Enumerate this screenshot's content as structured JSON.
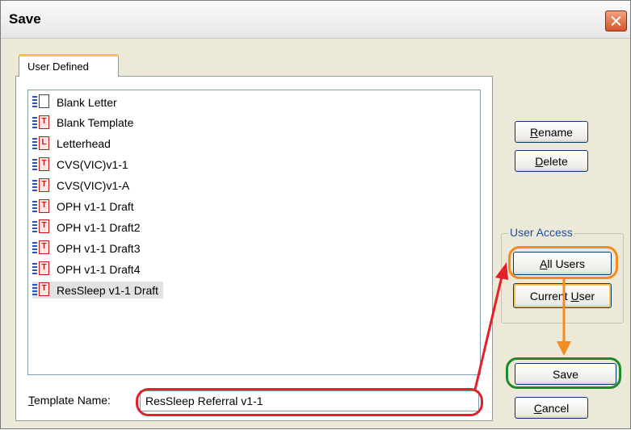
{
  "dialog": {
    "title": "Save"
  },
  "tabs": [
    {
      "label": "User Defined",
      "selected": true
    }
  ],
  "templates": [
    {
      "label": "Blank Letter",
      "icon": "blank-letter-icon",
      "glyph": "",
      "selected": false
    },
    {
      "label": "Blank Template",
      "icon": "template-icon",
      "glyph": "T",
      "selected": false
    },
    {
      "label": "Letterhead",
      "icon": "letterhead-icon",
      "glyph": "L",
      "selected": false
    },
    {
      "label": "CVS(VIC)v1-1",
      "icon": "template-icon",
      "glyph": "T",
      "selected": false
    },
    {
      "label": "CVS(VIC)v1-A",
      "icon": "template-icon",
      "glyph": "T",
      "selected": false
    },
    {
      "label": "OPH v1-1 Draft",
      "icon": "template-icon",
      "glyph": "T",
      "selected": false
    },
    {
      "label": "OPH v1-1 Draft2",
      "icon": "template-icon",
      "glyph": "T",
      "selected": false
    },
    {
      "label": "OPH v1-1 Draft3",
      "icon": "template-icon",
      "glyph": "T",
      "selected": false
    },
    {
      "label": "OPH v1-1 Draft4",
      "icon": "template-icon",
      "glyph": "T",
      "selected": false
    },
    {
      "label": "ResSleep v1-1 Draft",
      "icon": "template-icon",
      "glyph": "T",
      "selected": true
    }
  ],
  "buttons": {
    "rename": {
      "label": "Rename",
      "mnemonic": "R",
      "rest": "ename"
    },
    "delete": {
      "label": "Delete",
      "mnemonic": "D",
      "rest": "elete"
    },
    "save": {
      "label": "Save"
    },
    "cancel": {
      "label": "Cancel",
      "mnemonic": "C",
      "rest": "ancel"
    }
  },
  "user_access": {
    "legend": "User Access",
    "all_users": {
      "label": "All Users",
      "mnemonic": "A",
      "rest": "ll Users"
    },
    "current_user": {
      "label": "Current User",
      "before": "Current ",
      "mnemonic": "U",
      "rest": "ser"
    }
  },
  "template_name": {
    "label": "Template Name:",
    "mnemonic": "T",
    "rest": "emplate Name:",
    "value": "ResSleep Referral v1-1"
  },
  "colors": {
    "highlight_orange": "#f28b21",
    "highlight_green": "#1e8a2c",
    "highlight_red": "#e4202a",
    "group_legend": "#1c4ea6",
    "tab_accent": "#f3c24f"
  }
}
